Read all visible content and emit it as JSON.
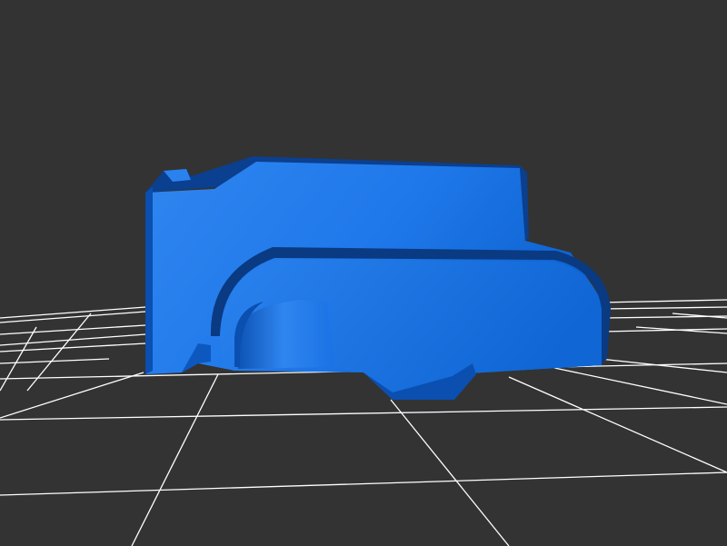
{
  "scene": {
    "background_color": "#333333",
    "grid_color": "#ffffff",
    "model_color": "#1a6fe6",
    "model_highlight_color": "#2f86f0",
    "model_shadow_color": "#0b3f8f",
    "model_edge_color": "#072e6a"
  }
}
